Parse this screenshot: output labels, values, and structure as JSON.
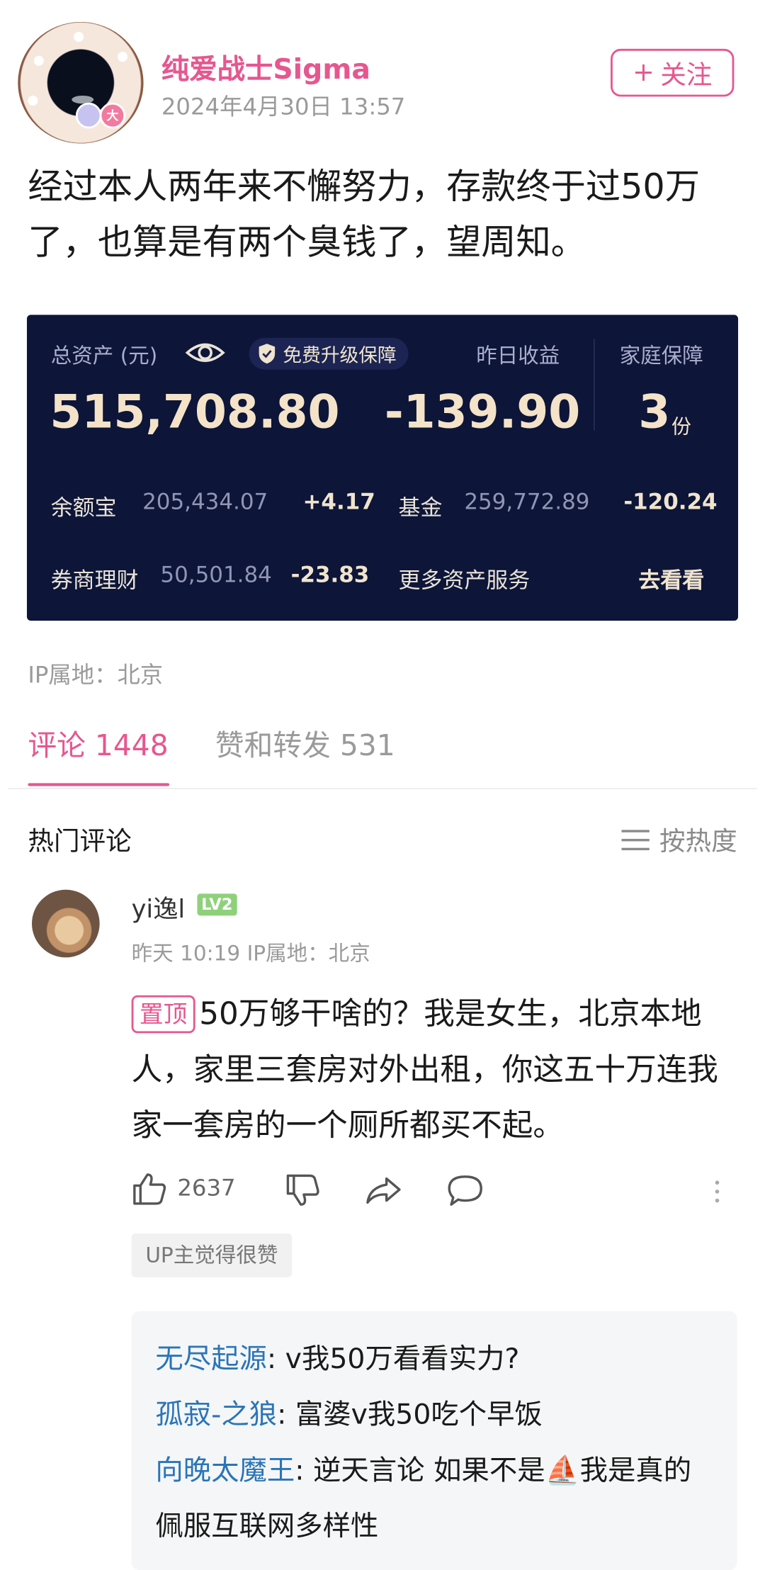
{
  "post": {
    "author": "纯爱战士Sigma",
    "time": "2024年4月30日 13:57",
    "follow_plus": "+",
    "follow_label": "关注",
    "badge": "大",
    "text": "经过本人两年来不懈努力，存款终于过50万了，也算是有两个臭钱了，望周知。",
    "ip": "IP属地：北京"
  },
  "card": {
    "total_label": "总资产 (元)",
    "upgrade_label": "免费升级保障",
    "yesterday_label": "昨日收益",
    "family_label": "家庭保障",
    "total_value": "515,708.80",
    "yesterday_value": "-139.90",
    "family_value": "3",
    "family_unit": "份",
    "rows": [
      {
        "label": "余额宝",
        "value": "205,434.07",
        "delta": "+4.17"
      },
      {
        "label": "基金",
        "value": "259,772.89",
        "delta": "-120.24"
      },
      {
        "label": "券商理财",
        "value": "50,501.84",
        "delta": "-23.83"
      }
    ],
    "more_label": "更多资产服务",
    "more_link": "去看看"
  },
  "tabs": {
    "comments": "评论 1448",
    "likes": "赞和转发 531"
  },
  "comments_header": {
    "title": "热门评论",
    "sort": "按热度"
  },
  "comment": {
    "user": "yi逸l",
    "level": "LV2",
    "meta": "昨天 10:19  IP属地：北京",
    "pin": "置顶",
    "text": "50万够干啥的？我是女生，北京本地人，家里三套房对外出租，你这五十万连我家一套房的一个厕所都买不起。",
    "likes": "2637",
    "up_tag": "UP主觉得很赞"
  },
  "replies": [
    {
      "user": "无尽起源",
      "text": ": v我50万看看实力?"
    },
    {
      "user": "孤寂-之狼",
      "text": ": 富婆v我50吃个早饭"
    },
    {
      "user": "向晚太魔王",
      "text": ": 逆天言论  如果不是⛵我是真的佩服互联网多样性"
    }
  ],
  "colors": {
    "accent": "#e6578f",
    "card_bg": "#0d1538",
    "card_gold": "#f4e3c8",
    "reply_user": "#2a75b8",
    "level_green": "#8fd17b"
  },
  "icons": [
    "eye-icon",
    "shield-icon",
    "menu-icon",
    "thumb-up-icon",
    "thumb-down-icon",
    "share-icon",
    "comment-icon",
    "more-icon"
  ]
}
